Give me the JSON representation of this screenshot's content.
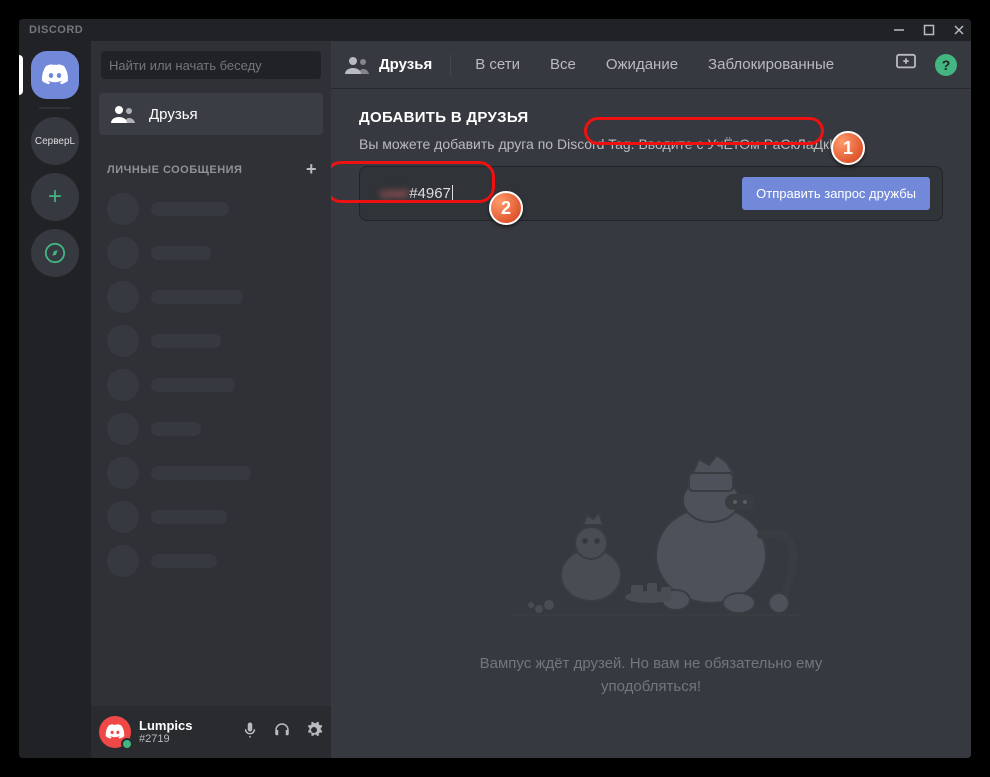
{
  "titlebar": {
    "app_name": "DISCORD"
  },
  "guilds": {
    "server_label": "СерверL"
  },
  "channels": {
    "search_placeholder": "Найти или начать беседу",
    "friends_label": "Друзья",
    "dm_header": "ЛИЧНЫЕ СООБЩЕНИЯ"
  },
  "user_panel": {
    "username": "Lumpics",
    "tag": "#2719"
  },
  "topbar": {
    "friends_label": "Друзья",
    "tabs": {
      "online": "В сети",
      "all": "Все",
      "pending": "Ожидание",
      "blocked": "Заблокированные"
    },
    "help_glyph": "?"
  },
  "add_friend": {
    "title": "ДОБАВИТЬ В ДРУЗЬЯ",
    "desc_prefix": "Вы можете добавить друга по Discord Tag. ",
    "desc_highlight": "Вводите с УчЁтОм РаСкЛаДкИ!",
    "input_blur": "user",
    "input_value": "#4967",
    "send_button": "Отправить запрос дружбы"
  },
  "empty_state": {
    "line1": "Вампус ждёт друзей. Но вам не обязательно ему",
    "line2": "уподобляться!"
  },
  "annotations": {
    "badge1": "1",
    "badge2": "2"
  }
}
